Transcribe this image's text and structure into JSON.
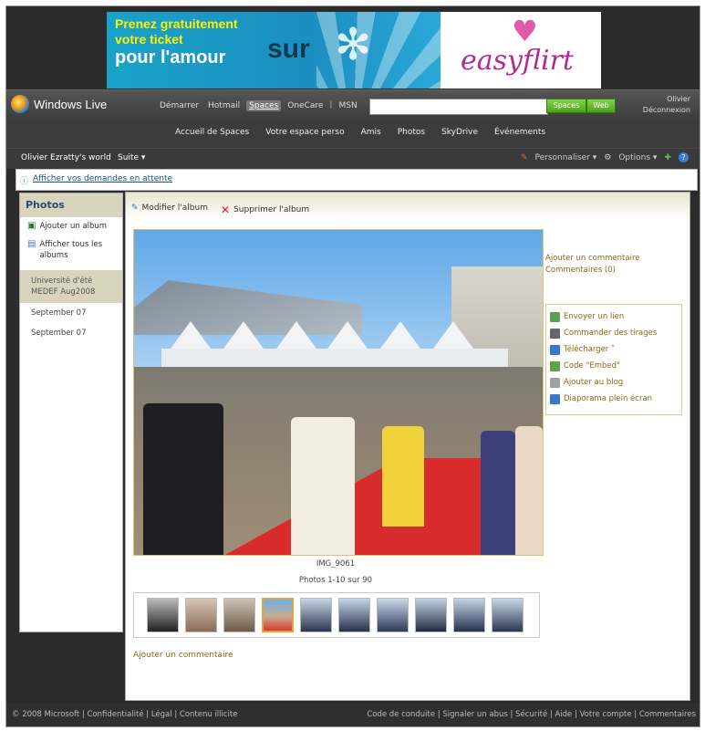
{
  "banner": {
    "line1": "Prenez gratuitement",
    "line2": "votre ticket",
    "line3": "pour l'amour",
    "sur": "sur",
    "brand": "easyflirt"
  },
  "topbar": {
    "logo_text": "Windows Live",
    "nav": [
      "Démarrer",
      "Hotmail",
      "Spaces",
      "OneCare",
      "MSN"
    ],
    "active_nav": "Spaces",
    "search_placeholder": "",
    "btn_spaces": "Spaces",
    "btn_web": "Web",
    "user_name": "Olivier",
    "logout": "Déconnexion"
  },
  "spacenav": {
    "links": [
      "Accueil de Spaces",
      "Votre espace perso",
      "Amis",
      "Photos",
      "SkyDrive",
      "Événements"
    ]
  },
  "worldbar": {
    "title": "Olivier Ezratty's world",
    "suite": "Suite ▾",
    "personalize": "Personnaliser ▾",
    "options": "Options ▾"
  },
  "pending": {
    "text": "Afficher vos demandes en attente"
  },
  "sidebar": {
    "title": "Photos",
    "add_album": "Ajouter un album",
    "show_all": "Afficher tous les albums",
    "selected": "Université d'été MEDEF Aug2008",
    "items": [
      "September 07",
      "September 07"
    ]
  },
  "main": {
    "edit_album": "Modifier l'album",
    "delete_album": "Supprimer l'album",
    "photo_name": "IMG_9061",
    "photo_count": "Photos 1-10 sur 90",
    "add_comment_right": "Ajouter un commentaire",
    "comments_count": "Commentaires (0)",
    "add_comment_bottom": "Ajouter un commentaire",
    "actions": [
      "Envoyer un lien",
      "Commander des tirages",
      "Télécharger ˅",
      "Code \"Embed\"",
      "Ajouter au blog",
      "Diaporama plein écran"
    ]
  },
  "footer": {
    "left": "© 2008 Microsoft | Confidentialité | Légal | Contenu illicite",
    "right": "Code de conduite | Signaler un abus | Sécurité | Aide | Votre compte | Commentaires"
  },
  "colors": {
    "accent_green": "#4ea21c",
    "link_brown": "#8a6a1a",
    "sidebar_bg": "#d8d4bd",
    "chrome_dark": "#3a3a3a"
  }
}
